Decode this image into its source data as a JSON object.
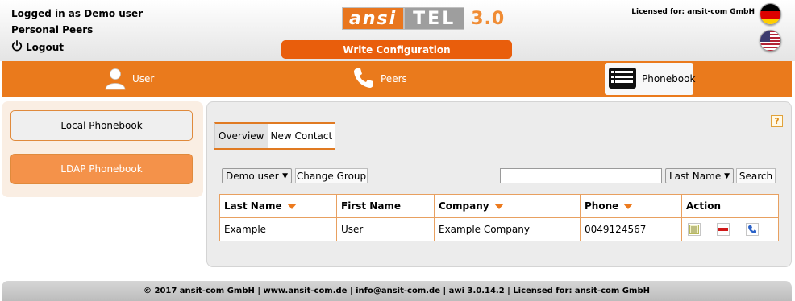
{
  "header": {
    "login_text": "Logged in as Demo user",
    "peers_text": "Personal Peers",
    "logout_label": "Logout",
    "logo": {
      "part1": "ansi",
      "part2": "TEL",
      "version": "3.0"
    },
    "write_config_label": "Write Configuration",
    "license_text": "Licensed for: ansit-com GmbH",
    "flags": [
      "german-flag-icon",
      "us-flag-icon"
    ]
  },
  "nav": {
    "items": [
      {
        "label": "User",
        "icon": "user-icon"
      },
      {
        "label": "Peers",
        "icon": "phone-icon"
      },
      {
        "label": "Phonebook",
        "icon": "phonebook-icon",
        "active": true
      }
    ]
  },
  "sidebar": {
    "items": [
      {
        "label": "Local Phonebook"
      },
      {
        "label": "LDAP Phonebook",
        "active": true
      }
    ]
  },
  "main": {
    "help_label": "?",
    "tabs": [
      {
        "label": "Overview"
      },
      {
        "label": "New Contact",
        "active": true
      }
    ],
    "group_select_value": "Demo user",
    "change_group_label": "Change Group",
    "search_value": "",
    "sort_select_value": "Last Name",
    "search_button_label": "Search",
    "table": {
      "headers": [
        "Last Name",
        "First Name",
        "Company",
        "Phone",
        "Action"
      ],
      "rows": [
        {
          "last_name": "Example",
          "first_name": "User",
          "company": "Example Company",
          "phone": "0049124567",
          "actions": [
            "edit-icon",
            "delete-icon",
            "dial-icon"
          ]
        }
      ]
    }
  },
  "footer": {
    "text": "© 2017 ansit-com GmbH | www.ansit-com.de | info@ansit-com.de | awi 3.0.14.2 | Licensed for: ansit-com GmbH"
  },
  "colors": {
    "accent": "#ea7a1c",
    "write_config": "#e95e0c",
    "sidebar_active": "#f4924a"
  }
}
